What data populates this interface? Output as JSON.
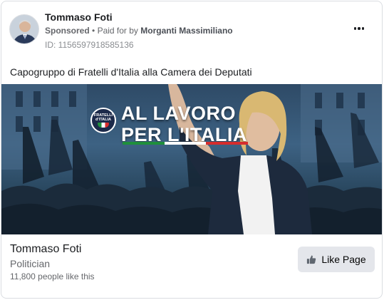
{
  "header": {
    "page_name": "Tommaso Foti",
    "sponsored_label": "Sponsored",
    "separator": "•",
    "paid_for_prefix": "Paid for by",
    "funder": "Morganti Massimiliano",
    "ad_id": "ID: 1156597918585136",
    "more_icon": "more-horizontal-icon"
  },
  "body": {
    "text": "Capogruppo di Fratelli d'Italia alla Camera dei Deputati"
  },
  "hero": {
    "title_line1": "AL LAVORO",
    "title_line2": "PER L'ITALIA",
    "logo_text_line1": "FRATELLI",
    "logo_text_line2": "d'ITALIA",
    "flag_colors": [
      "#1f8f3c",
      "#ffffff",
      "#d62d2d"
    ]
  },
  "footer": {
    "name": "Tommaso Foti",
    "category": "Politician",
    "likes": "11,800 people like this",
    "like_button_label": "Like Page",
    "like_icon": "thumbs-up-icon"
  },
  "colors": {
    "primary_text": "#1c1e21",
    "secondary_text": "#65676b",
    "button_bg": "#e4e6eb",
    "border": "#dadde1"
  }
}
